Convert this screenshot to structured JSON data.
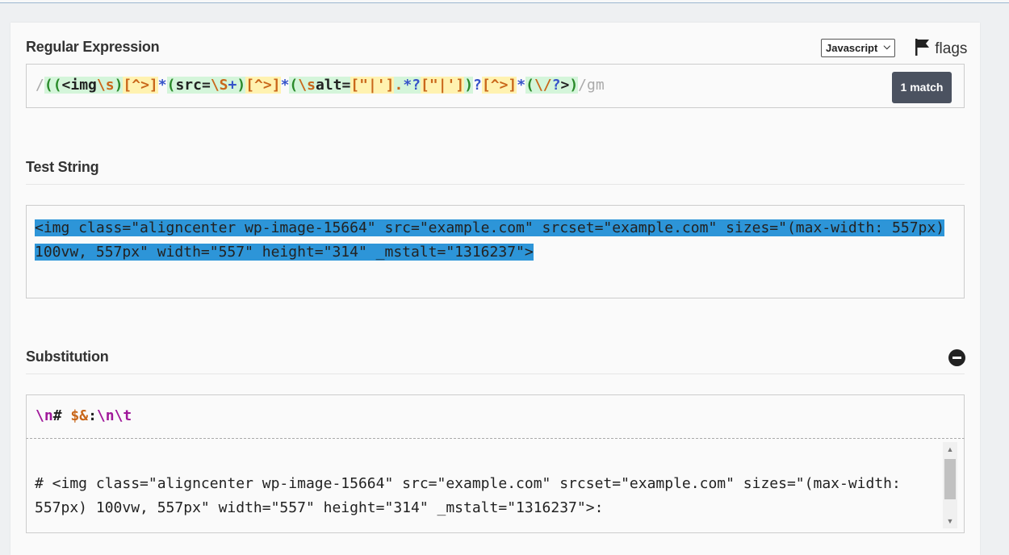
{
  "regex_section": {
    "title": "Regular Expression",
    "flavor": "Javascript",
    "flags_label": "flags",
    "match_count": "1 match",
    "delimiter_open": "/",
    "delimiter_close": "/",
    "flags": "gm",
    "pattern_tokens": [
      {
        "text": "(",
        "cls": "paren g1"
      },
      {
        "text": "(",
        "cls": "paren g1"
      },
      {
        "text": "<img",
        "cls": "lit g1"
      },
      {
        "text": "\\s",
        "cls": "esc g1"
      },
      {
        "text": ")",
        "cls": "paren g1"
      },
      {
        "text": "[^>]",
        "cls": "cls"
      },
      {
        "text": "*",
        "cls": "quant"
      },
      {
        "text": "(",
        "cls": "paren g1"
      },
      {
        "text": "src=",
        "cls": "lit g1"
      },
      {
        "text": "\\S",
        "cls": "esc g1"
      },
      {
        "text": "+",
        "cls": "quant g1"
      },
      {
        "text": ")",
        "cls": "paren g1"
      },
      {
        "text": "[^>]",
        "cls": "cls"
      },
      {
        "text": "*",
        "cls": "quant"
      },
      {
        "text": "(",
        "cls": "paren g1"
      },
      {
        "text": "\\s",
        "cls": "esc g1"
      },
      {
        "text": "alt=",
        "cls": "lit g1"
      },
      {
        "text": "[\"|']",
        "cls": "cls lit"
      },
      {
        "text": ".",
        "cls": "esc g1"
      },
      {
        "text": "*?",
        "cls": "quant g1"
      },
      {
        "text": "[\"|']",
        "cls": "cls lit"
      },
      {
        "text": ")",
        "cls": "paren g1"
      },
      {
        "text": "?",
        "cls": "quant"
      },
      {
        "text": "[^>]",
        "cls": "cls"
      },
      {
        "text": "*",
        "cls": "quant"
      },
      {
        "text": "(",
        "cls": "paren g1"
      },
      {
        "text": "\\/",
        "cls": "esc g1"
      },
      {
        "text": "?",
        "cls": "quant g1"
      },
      {
        "text": ">",
        "cls": "lit g1"
      },
      {
        "text": ")",
        "cls": "paren g1"
      }
    ]
  },
  "test_section": {
    "title": "Test String",
    "text": "<img class=\"aligncenter wp-image-15664\" src=\"example.com\" srcset=\"example.com\" sizes=\"(max-width: 557px) 100vw, 557px\" width=\"557\" height=\"314\" _mstalt=\"1316237\">"
  },
  "substitution_section": {
    "title": "Substitution",
    "tokens": [
      {
        "text": "\\n",
        "cls": "nl"
      },
      {
        "text": "# ",
        "cls": "hash"
      },
      {
        "text": "$&",
        "cls": "amp"
      },
      {
        "text": ":",
        "cls": "hash"
      },
      {
        "text": "\\n\\t",
        "cls": "nl"
      }
    ],
    "result": "# <img class=\"aligncenter wp-image-15664\" src=\"example.com\" srcset=\"example.com\" sizes=\"(max-width: 557px) 100vw, 557px\" width=\"557\" height=\"314\" _mstalt=\"1316237\">:"
  },
  "colors": {
    "match_badge": "#4b5260",
    "selection": "#2d95d8",
    "group_bg": "#d4f5da",
    "class_bg": "#fff2b0"
  }
}
